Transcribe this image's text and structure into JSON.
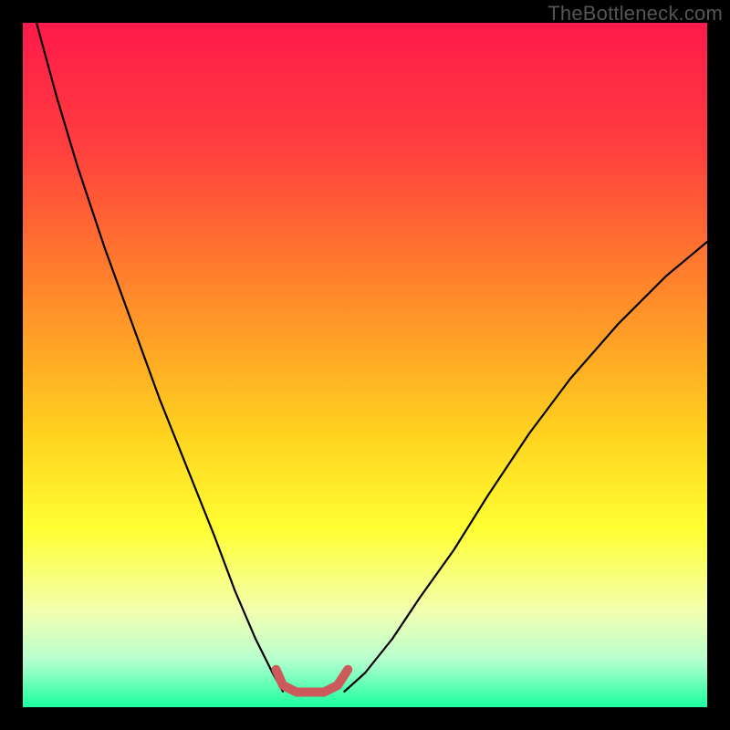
{
  "watermark": "TheBottleneck.com",
  "chart_data": {
    "type": "line",
    "title": "",
    "xlabel": "",
    "ylabel": "",
    "xlim": [
      0,
      100
    ],
    "ylim": [
      0,
      100
    ],
    "background_gradient": {
      "stops": [
        {
          "offset": 0.0,
          "color": "#ff1a4b"
        },
        {
          "offset": 0.18,
          "color": "#ff3e3e"
        },
        {
          "offset": 0.4,
          "color": "#ff8a2a"
        },
        {
          "offset": 0.6,
          "color": "#ffd21f"
        },
        {
          "offset": 0.74,
          "color": "#ffff33"
        },
        {
          "offset": 0.86,
          "color": "#f3ffb0"
        },
        {
          "offset": 0.93,
          "color": "#b8ffcf"
        },
        {
          "offset": 1.0,
          "color": "#1aff9e"
        }
      ]
    },
    "series": [
      {
        "name": "left-branch",
        "x": [
          2,
          5,
          8,
          12,
          16,
          20,
          24,
          28,
          31,
          34,
          36.5,
          38
        ],
        "y": [
          100,
          89,
          79,
          67,
          56,
          45,
          35,
          25,
          17,
          10,
          5,
          2.3
        ],
        "stroke": "#000000",
        "stroke_width": 2.2
      },
      {
        "name": "right-branch",
        "x": [
          47,
          50,
          54,
          58,
          63,
          68,
          74,
          80,
          87,
          94,
          100
        ],
        "y": [
          2.3,
          5,
          10,
          16,
          23,
          31,
          40,
          48,
          56,
          63,
          68
        ],
        "stroke": "#000000",
        "stroke_width": 2.2
      },
      {
        "name": "bottom-bracket",
        "x": [
          37,
          38,
          40,
          44,
          46,
          47.5
        ],
        "y": [
          5.5,
          3.2,
          2.2,
          2.2,
          3.2,
          5.5
        ],
        "stroke": "#cc5a5a",
        "stroke_width": 10
      }
    ]
  }
}
